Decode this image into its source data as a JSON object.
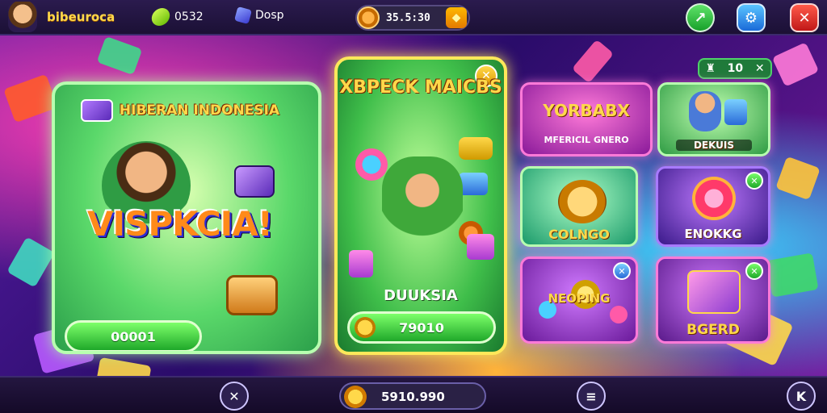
{
  "topbar": {
    "username": "bibeuroca",
    "gems": "0532",
    "cubes": "Dosp",
    "timer": "35.5:30"
  },
  "cards": {
    "left": {
      "title": "HIBERAN INDONESIA",
      "logo": "VISPKCIA!",
      "button": "00001"
    },
    "center": {
      "title": "XBPECK MAICBS",
      "label": "DUUKSIA",
      "button": "79010"
    }
  },
  "grid": {
    "top_left": {
      "title": "YORBABX",
      "subtitle": "MFERICIL GNERO"
    },
    "top_right": {
      "title": "DEKUIS"
    },
    "mid_left": {
      "title": "COLNGO"
    },
    "mid_right": {
      "title": "ENOKKG"
    },
    "bottom_left": {
      "title": "NEOPING"
    },
    "bottom_right": {
      "title": "BGERD"
    }
  },
  "level_tag": "10",
  "bottombar": {
    "balance": "5910.990"
  }
}
